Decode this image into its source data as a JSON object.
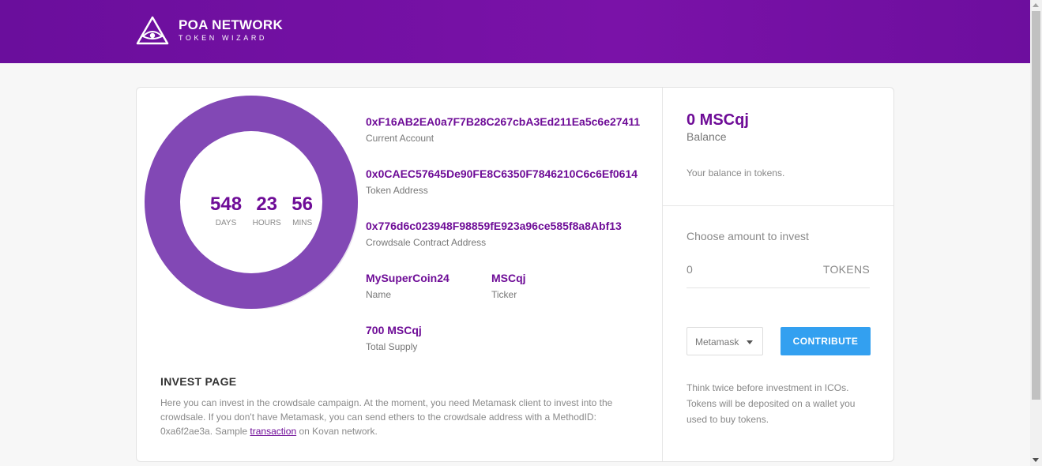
{
  "header": {
    "logo_title": "POA NETWORK",
    "logo_subtitle": "TOKEN WIZARD"
  },
  "timer": {
    "days": "548",
    "days_label": "DAYS",
    "hours": "23",
    "hours_label": "HOURS",
    "mins": "56",
    "mins_label": "MINS",
    "ring_color": "#8248b5"
  },
  "info": {
    "current_account": "0xF16AB2EA0a7F7B28C267cbA3Ed211Ea5c6e27411",
    "current_account_label": "Current Account",
    "token_address": "0x0CAEC57645De90FE8C6350F7846210C6c6Ef0614",
    "token_address_label": "Token Address",
    "crowdsale_address": "0x776d6c023948F98859fE923a96ce585f8a8Abf13",
    "crowdsale_address_label": "Crowdsale Contract Address",
    "name": "MySuperCoin24",
    "name_label": "Name",
    "ticker": "MSCqj",
    "ticker_label": "Ticker",
    "total_supply": "700 MSCqj",
    "total_supply_label": "Total Supply"
  },
  "invest": {
    "title": "INVEST PAGE",
    "text_before": "Here you can invest in the crowdsale campaign. At the moment, you need Metamask client to invest into the crowdsale. If you don't have Metamask, you can send ethers to the crowdsale address with a MethodID: 0xa6f2ae3a. Sample ",
    "link": "transaction",
    "text_after": " on Kovan network."
  },
  "balance": {
    "value": "0 MSCqj",
    "label": "Balance",
    "hint": "Your balance in tokens."
  },
  "contribute": {
    "choose_label": "Choose amount to invest",
    "amount_value": "0",
    "amount_unit": "TOKENS",
    "wallet_selected": "Metamask",
    "button_label": "CONTRIBUTE",
    "warning": "Think twice before investment in ICOs. Tokens will be deposited on a wallet you used to buy tokens."
  },
  "colors": {
    "brand": "#6e0c97",
    "button": "#33a0f0"
  }
}
